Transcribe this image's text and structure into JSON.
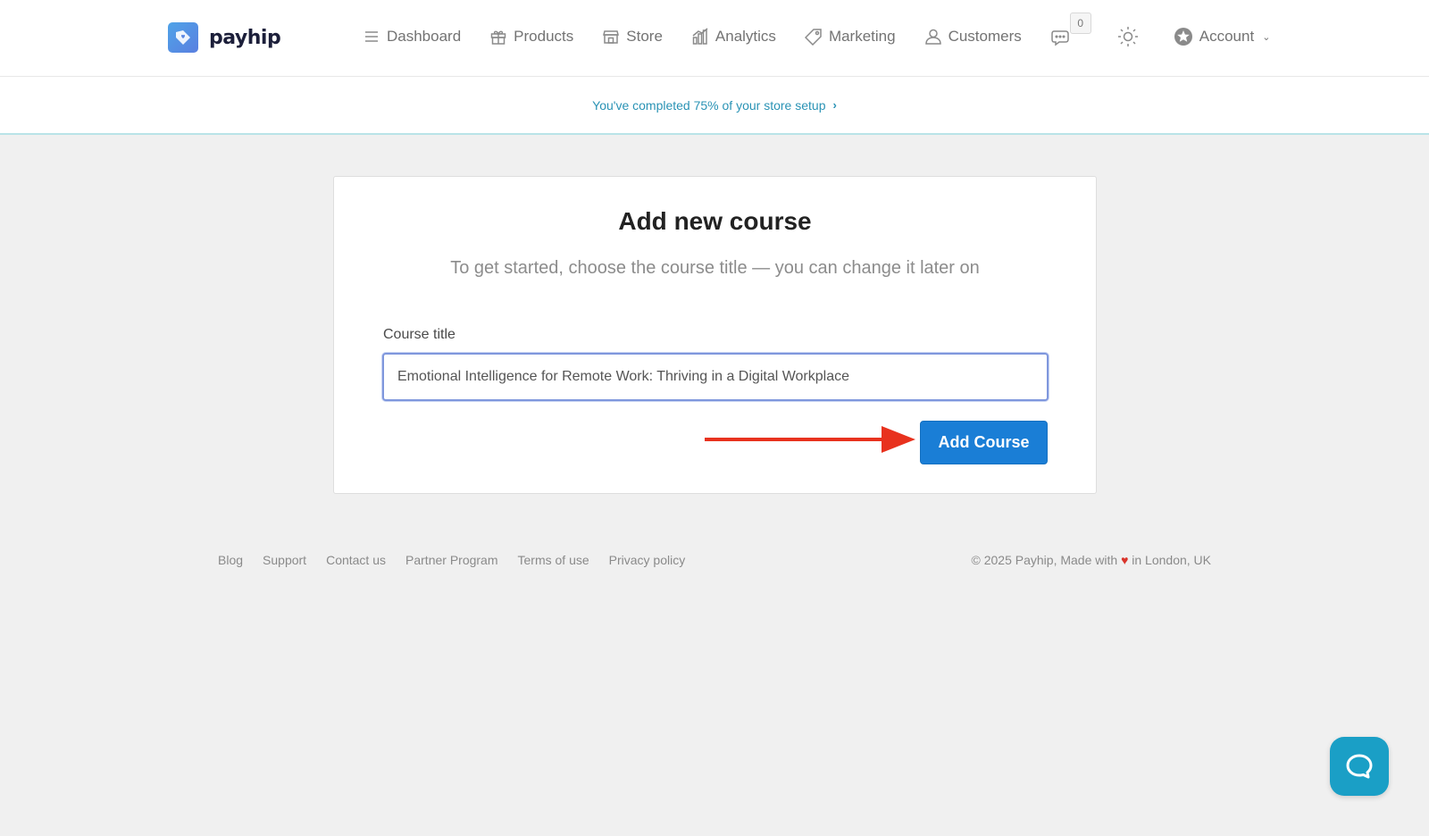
{
  "brand": {
    "name": "payhip"
  },
  "nav": {
    "items": [
      {
        "label": "Dashboard",
        "icon": "menu-lines-icon"
      },
      {
        "label": "Products",
        "icon": "gift-icon"
      },
      {
        "label": "Store",
        "icon": "storefront-icon"
      },
      {
        "label": "Analytics",
        "icon": "bar-chart-icon"
      },
      {
        "label": "Marketing",
        "icon": "tag-icon"
      },
      {
        "label": "Customers",
        "icon": "user-icon"
      }
    ],
    "chat_badge_count": "0",
    "account_label": "Account"
  },
  "setup_banner": {
    "text": "You've completed 75% of your store setup",
    "arrow": "›",
    "progress_percent": 75
  },
  "card": {
    "title": "Add new course",
    "subtitle": "To get started, choose the course title — you can change it later on",
    "field_label": "Course title",
    "field_value": "Emotional Intelligence for Remote Work: Thriving in a Digital Workplace",
    "button_label": "Add Course"
  },
  "footer": {
    "links": [
      "Blog",
      "Support",
      "Contact us",
      "Partner Program",
      "Terms of use",
      "Privacy policy"
    ],
    "copyright_prefix": "© 2025 Payhip, Made with",
    "heart": "♥",
    "copyright_suffix": "in London, UK"
  },
  "colors": {
    "primary_button": "#1a7ed6",
    "link": "#2a93b5",
    "annotation_arrow": "#e8321e",
    "help_bubble": "#1a9fc6"
  }
}
